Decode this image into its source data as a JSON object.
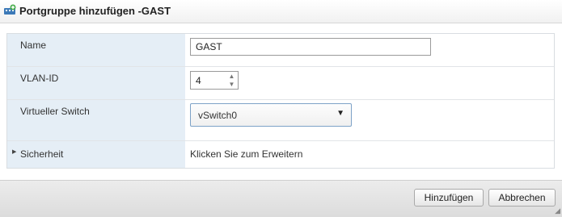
{
  "dialog": {
    "title": "Portgruppe hinzufügen -GAST",
    "icon": "portgroup-icon"
  },
  "form": {
    "name_label": "Name",
    "name_value": "GAST",
    "vlan_label": "VLAN-ID",
    "vlan_value": "4",
    "switch_label": "Virtueller Switch",
    "switch_value": "vSwitch0",
    "security_label": "Sicherheit",
    "security_info": "Klicken Sie zum Erweitern"
  },
  "footer": {
    "add_label": "Hinzufügen",
    "cancel_label": "Abbrechen"
  },
  "colors": {
    "label_background": "#e5eef6",
    "select_border": "#7da2c7"
  }
}
